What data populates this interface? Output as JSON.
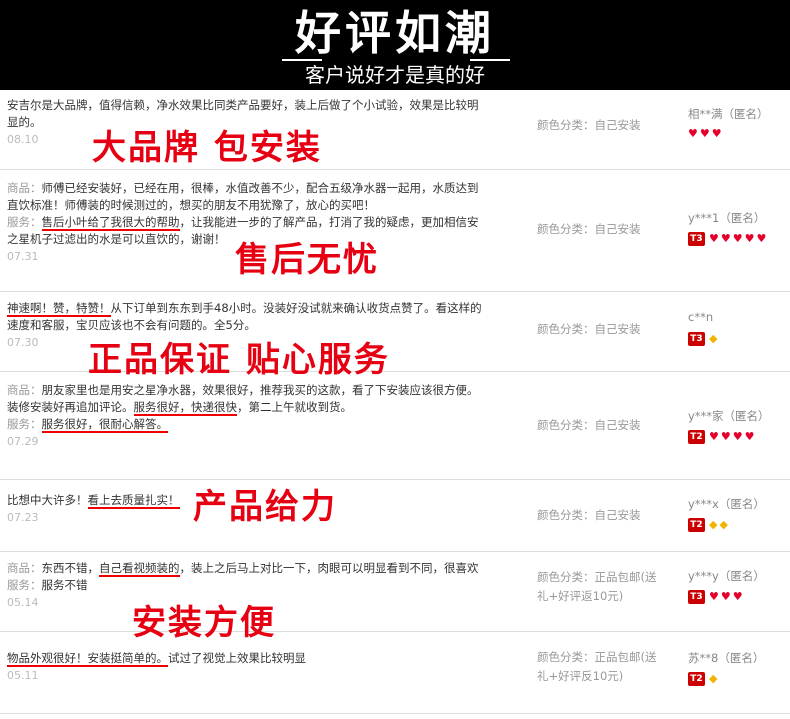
{
  "header": {
    "title": "好评如潮",
    "subtitle": "客户说好才是真的好"
  },
  "reviews": [
    {
      "lines": [
        [
          {
            "t": "安吉尔是大品牌，值得信赖，净水效果比同类产品要好，装上后做了个小试验，效果是比较明"
          }
        ],
        [
          {
            "t": "显的。"
          }
        ]
      ],
      "date": "08.10",
      "color_label": "颜色分类：",
      "color_value": "自己安装",
      "user": "相**满（匿名）",
      "badge": "",
      "hearts": 3,
      "diamonds": 0
    },
    {
      "lines": [
        [
          {
            "t": "商品：",
            "p": true
          },
          {
            "t": "师傅已经安装好，已经在用，很棒，水值改善不少，配合五级净水器一起用，水质达到"
          }
        ],
        [
          {
            "t": "直饮标准！师傅装的时候测过的，想买的朋友不用犹豫了，放心的买吧！"
          }
        ],
        [
          {
            "t": "服务：",
            "p": true
          },
          {
            "t": "售后小叶给了我很大的帮助",
            "u": true
          },
          {
            "t": "，让我能进一步的了解产品，打消了我的疑虑，更加相信安"
          }
        ],
        [
          {
            "t": "之星机子过滤出的水是可以直饮的，谢谢！"
          }
        ]
      ],
      "date": "07.31",
      "color_label": "颜色分类：",
      "color_value": "自己安装",
      "user": "y***1（匿名）",
      "badge": "T3",
      "hearts": 5,
      "diamonds": 0
    },
    {
      "lines": [
        [
          {
            "t": "神速啊！赞，特赞！",
            "u": true
          },
          {
            "t": "从下订单到东东到手48小时。没装好没试就来确认收货点赞了。看这样的"
          }
        ],
        [
          {
            "t": "速度和客服，宝贝应该也不会有问题的。全5分。"
          }
        ]
      ],
      "date": "07.30",
      "color_label": "颜色分类：",
      "color_value": "自己安装",
      "user": "c**n",
      "badge": "T3",
      "hearts": 0,
      "diamonds": 1
    },
    {
      "lines": [
        [
          {
            "t": "商品：",
            "p": true
          },
          {
            "t": "朋友家里也是用安之星净水器，效果很好，推荐我买的这款，看了下安装应该很方便。"
          }
        ],
        [
          {
            "t": "装修安装好再追加评论。"
          },
          {
            "t": "服务很好，快递很快",
            "u": true
          },
          {
            "t": "，第二上午就收到货。"
          }
        ],
        [
          {
            "t": "服务：",
            "p": true
          },
          {
            "t": "服务很好，很耐心解答。",
            "u": true
          }
        ]
      ],
      "date": "07.29",
      "color_label": "颜色分类：",
      "color_value": "自己安装",
      "user": "y***家（匿名）",
      "badge": "T2",
      "hearts": 4,
      "diamonds": 0
    },
    {
      "lines": [
        [
          {
            "t": "比想中大许多！"
          },
          {
            "t": "看上去质量扎实！",
            "u": true
          }
        ]
      ],
      "date": "07.23",
      "color_label": "颜色分类：",
      "color_value": "自己安装",
      "user": "y***x（匿名）",
      "badge": "T2",
      "hearts": 0,
      "diamonds": 2
    },
    {
      "lines": [
        [
          {
            "t": "商品：",
            "p": true
          },
          {
            "t": "东西不错，"
          },
          {
            "t": "自己看视频装的",
            "u": true
          },
          {
            "t": "，装上之后马上对比一下，肉眼可以明显看到不同，很喜欢"
          }
        ],
        [
          {
            "t": "服务：",
            "p": true
          },
          {
            "t": "服务不错"
          }
        ]
      ],
      "date": "05.14",
      "color_label": "颜色分类：",
      "color_value": "正品包邮(送",
      "color_value2": "礼+好评返10元)",
      "user": "y***y（匿名）",
      "badge": "T3",
      "hearts": 3,
      "diamonds": 0
    },
    {
      "lines": [
        [
          {
            "t": "物品外观很好！安装挺简单的。",
            "u": true
          },
          {
            "t": "试过了视觉上效果比较明显"
          }
        ]
      ],
      "date": "05.11",
      "color_label": "颜色分类：",
      "color_value": "正品包邮(送",
      "color_value2": "礼+好评反10元)",
      "user": "苏**8（匿名）",
      "badge": "T2",
      "hearts": 0,
      "diamonds": 1
    }
  ],
  "slogans": [
    "大品牌 包安装",
    "售后无忧",
    "正品保证 贴心服务",
    "产品给力",
    "安装方便"
  ]
}
